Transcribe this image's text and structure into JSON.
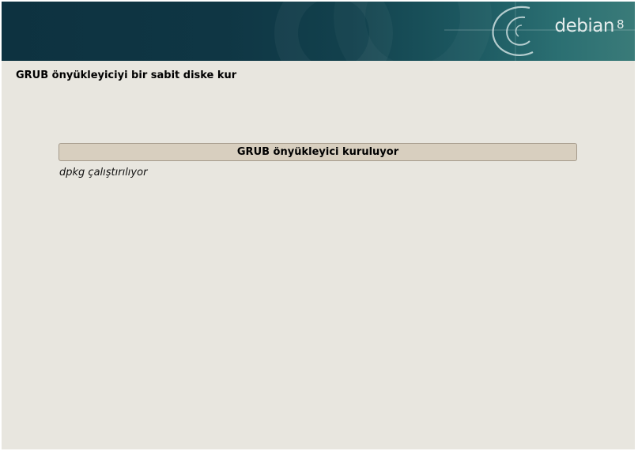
{
  "banner": {
    "brand_name": "debian",
    "brand_version": "8",
    "logo_icon": "debian-swirl-icon",
    "colors": {
      "dark": "#0d3240",
      "light": "#3a7b79"
    }
  },
  "page": {
    "title": "GRUB önyükleyiciyi bir sabit diske kur",
    "background": "#e8e6df"
  },
  "progress": {
    "label": "GRUB önyükleyici kuruluyor",
    "percent": 0,
    "status_text": "dpkg çalıştırılıyor"
  }
}
